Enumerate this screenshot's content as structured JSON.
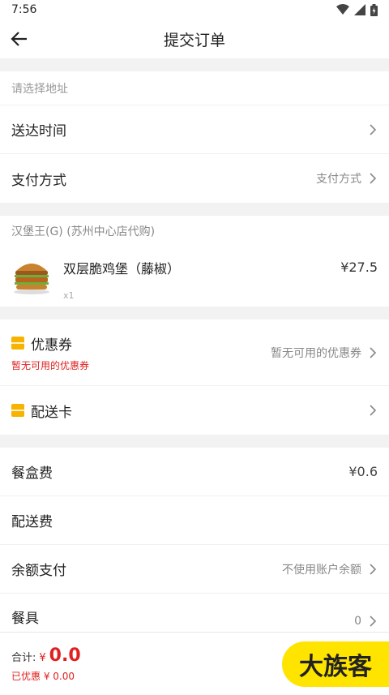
{
  "status": {
    "time": "7:56"
  },
  "header": {
    "title": "提交订单"
  },
  "address": {
    "placeholder": "请选择地址"
  },
  "delivery": {
    "time_label": "送达时间",
    "payment_label": "支付方式",
    "payment_value": "支付方式"
  },
  "store": {
    "name": "汉堡王(G) (苏州中心店代购)"
  },
  "product": {
    "name": "双层脆鸡堡（藤椒）",
    "qty": "x1",
    "price": "¥27.5"
  },
  "coupon": {
    "label": "优惠券",
    "sub": "暂无可用的优惠券",
    "value": "暂无可用的优惠券"
  },
  "delivery_card": {
    "label": "配送卡"
  },
  "fees": {
    "box_label": "餐盒费",
    "box_value": "¥0.6",
    "delivery_label": "配送费",
    "balance_label": "余额支付",
    "balance_value": "不使用账户余额",
    "tableware_label": "餐具",
    "tableware_value": "0"
  },
  "bottom": {
    "total_label": "合计:",
    "currency": "¥",
    "total_value": "0.0",
    "discount": "已优惠 ¥ 0.00",
    "submit_label": "大族客"
  },
  "colors": {
    "accent": "#ffe400",
    "price_red": "#e02020",
    "coupon_yellow": "#f6b400"
  }
}
